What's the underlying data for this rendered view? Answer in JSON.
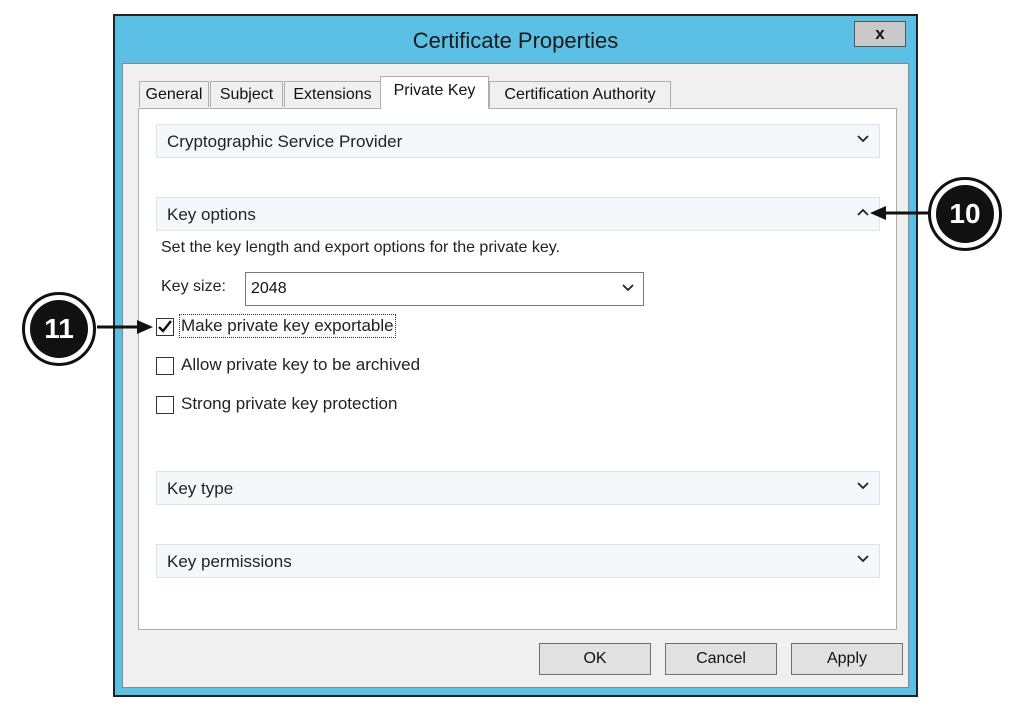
{
  "window": {
    "title": "Certificate Properties",
    "close_glyph": "x"
  },
  "tabs": [
    {
      "label": "General"
    },
    {
      "label": "Subject"
    },
    {
      "label": "Extensions"
    },
    {
      "label": "Private Key"
    },
    {
      "label": "Certification Authority"
    }
  ],
  "sections": {
    "csp": {
      "label": "Cryptographic Service Provider",
      "expanded": false
    },
    "key_options": {
      "label": "Key options",
      "expanded": true,
      "description": "Set the key length and export options for the private key.",
      "key_size_label": "Key size:",
      "key_size_value": "2048",
      "checkboxes": [
        {
          "label": "Make private key exportable",
          "checked": true
        },
        {
          "label": "Allow private key to be archived",
          "checked": false
        },
        {
          "label": "Strong private key protection",
          "checked": false
        }
      ]
    },
    "key_type": {
      "label": "Key type",
      "expanded": false
    },
    "key_permissions": {
      "label": "Key permissions",
      "expanded": false
    }
  },
  "buttons": {
    "ok": "OK",
    "cancel": "Cancel",
    "apply": "Apply"
  },
  "callouts": {
    "ten": "10",
    "eleven": "11"
  },
  "colors": {
    "titlebar": "#5cc0e4",
    "callout": "#111111"
  }
}
